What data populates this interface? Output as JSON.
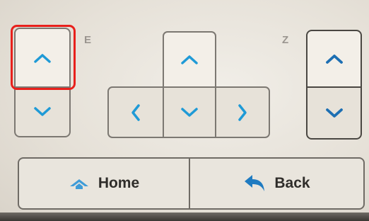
{
  "axis_labels": {
    "e": "E",
    "z": "Z"
  },
  "colors": {
    "arrow": "#1f9ad6",
    "highlight": "#e8201c",
    "home_icon": "#3f9cd8",
    "back_icon": "#1f7bc1"
  },
  "icons": {
    "e_up": "chevron-up-icon",
    "e_down": "chevron-down-icon",
    "xy_up": "chevron-up-icon",
    "xy_left": "chevron-left-icon",
    "xy_down": "chevron-down-icon",
    "xy_right": "chevron-right-icon",
    "z_up": "chevron-up-icon",
    "z_down": "chevron-down-icon",
    "home": "home-icon",
    "back": "back-arrow-icon"
  },
  "bottom": {
    "home_label": "Home",
    "back_label": "Back"
  }
}
